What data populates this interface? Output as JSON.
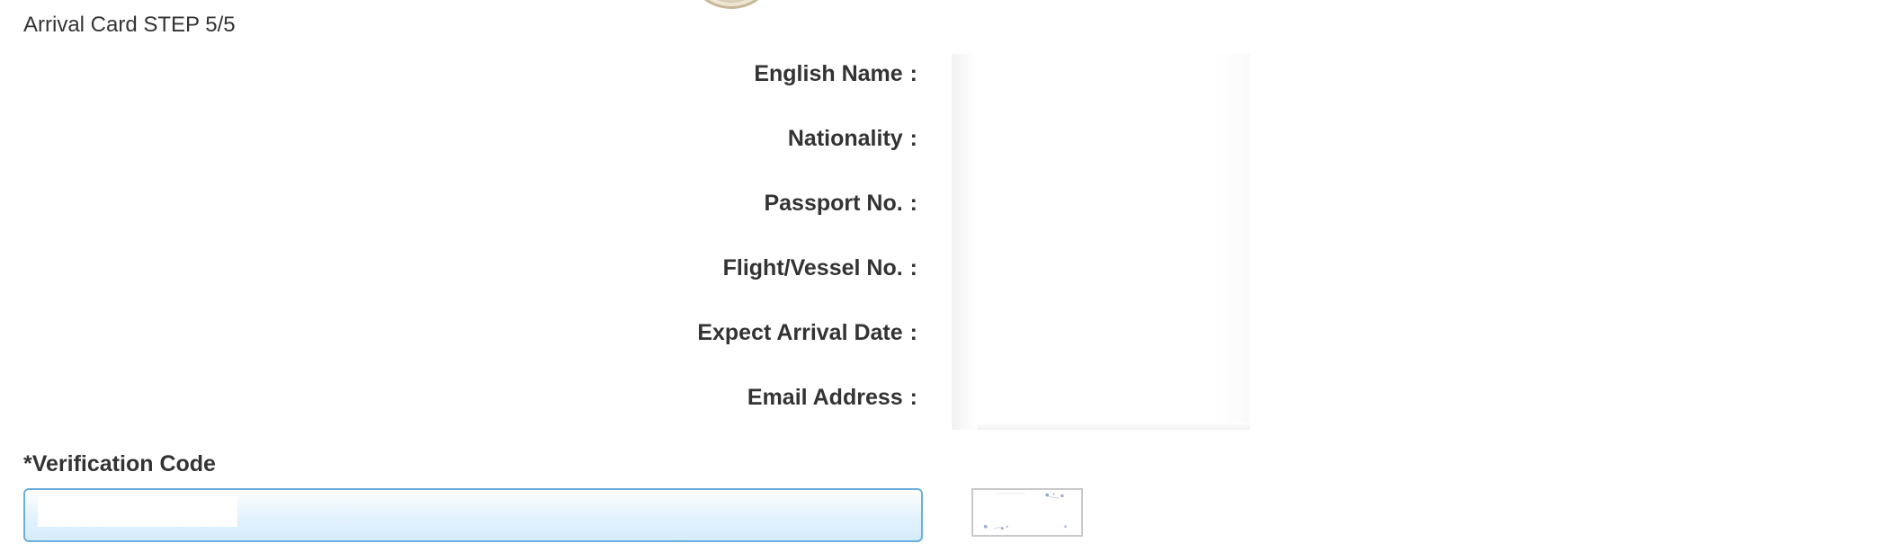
{
  "header": {
    "step_title": "Arrival Card STEP 5/5"
  },
  "summary": {
    "rows": [
      {
        "label": "English Name",
        "value": ""
      },
      {
        "label": "Nationality",
        "value": ""
      },
      {
        "label": "Passport No.",
        "value": ""
      },
      {
        "label": "Flight/Vessel No.",
        "value": ""
      },
      {
        "label": "Expect Arrival Date",
        "value": ""
      },
      {
        "label": "Email Address",
        "value": ""
      }
    ],
    "separator": ":"
  },
  "verification": {
    "label": "*Verification Code",
    "input_value": "",
    "input_placeholder": ""
  },
  "icons": {
    "emblem": "emblem-seal-icon",
    "captcha": "captcha-image"
  },
  "colors": {
    "text": "#333333",
    "input_border": "#6ab0de",
    "input_fill": "#e2f2fd",
    "captcha_border": "#c9c9c9"
  }
}
